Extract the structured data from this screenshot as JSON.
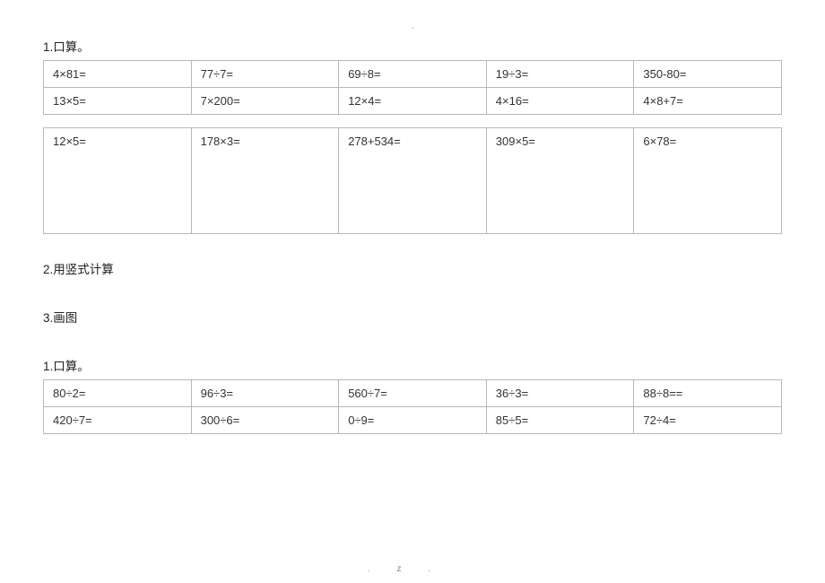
{
  "topDot": ".",
  "headings": {
    "h1": "1.口算。",
    "h2": "2.用竖式计算",
    "h3": "3.画图",
    "h4": "1.口算。"
  },
  "table1": {
    "rows": [
      [
        "4×81=",
        "77÷7=",
        "69÷8=",
        "19÷3=",
        "350-80="
      ],
      [
        "13×5=",
        "7×200=",
        "12×4=",
        "4×16=",
        "4×8+7="
      ]
    ]
  },
  "table2": {
    "rows": [
      [
        "12×5=",
        "178×3=",
        "278+534=",
        "309×5=",
        "6×78="
      ]
    ]
  },
  "table3": {
    "rows": [
      [
        "80÷2=",
        "96÷3=",
        "560÷7=",
        "36÷3=",
        "88÷8=="
      ],
      [
        "420÷7=",
        "300÷6=",
        "0÷9=",
        "85÷5=",
        "72÷4="
      ]
    ]
  },
  "footer": ".z."
}
